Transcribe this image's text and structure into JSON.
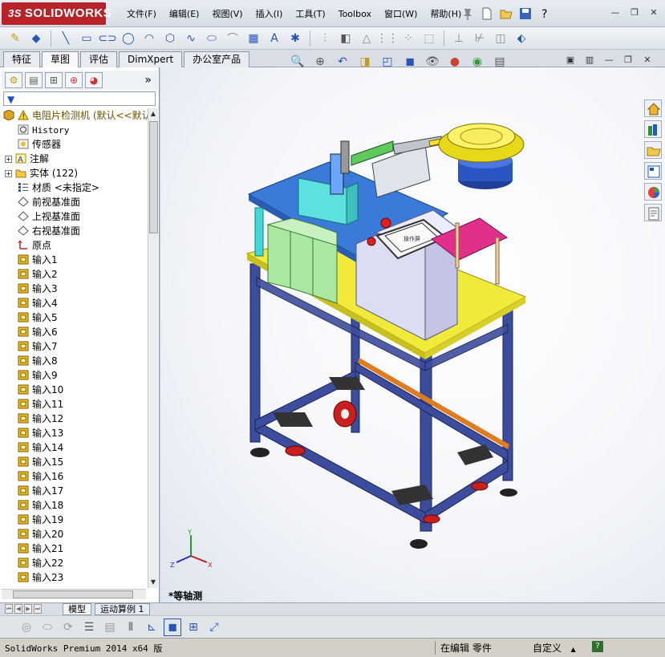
{
  "app": {
    "logo_text": "SOLIDWORKS",
    "logo_prefix": "3S"
  },
  "menu": [
    "文件(F)",
    "编辑(E)",
    "视图(V)",
    "插入(I)",
    "工具(T)",
    "Toolbox",
    "窗口(W)",
    "帮助(H)"
  ],
  "command_tabs": [
    "特征",
    "草图",
    "评估",
    "DimXpert",
    "办公室产品"
  ],
  "active_command_tab": "草图",
  "tree": {
    "root": "电阻片检测机  (默认<<默认",
    "history": "History",
    "sensors": "传感器",
    "annotations": "注解",
    "solid_bodies": "实体 (122)",
    "material": "材质 <未指定>",
    "front_plane": "前视基准面",
    "top_plane": "上视基准面",
    "right_plane": "右视基准面",
    "origin": "原点",
    "inputs": [
      "输入1",
      "输入2",
      "输入3",
      "输入4",
      "输入5",
      "输入6",
      "输入7",
      "输入8",
      "输入9",
      "输入10",
      "输入11",
      "输入12",
      "输入13",
      "输入14",
      "输入15",
      "输入16",
      "输入17",
      "输入18",
      "输入19",
      "输入20",
      "输入21",
      "输入22",
      "输入23"
    ]
  },
  "viewport": {
    "view_label": "*等轴测",
    "triad_x": "X",
    "triad_y": "Y",
    "triad_z": "Z",
    "hmi_screen_text": "操作屏"
  },
  "bottom_tabs": [
    "模型",
    "运动算例 1"
  ],
  "status": {
    "product": "SolidWorks Premium 2014 x64 版",
    "editing": "在编辑 零件",
    "custom": "自定义",
    "custom_arrow": "▲",
    "help": "?"
  },
  "colors": {
    "brand_red": "#b8232a",
    "frame_blue": "#3d4d9e",
    "table_yellow": "#f2ea3a",
    "plate_blue": "#3a7ad8",
    "panel_lavender": "#dcdcf2",
    "accent_magenta": "#e0308a",
    "bowl_yellow": "#e8d81a",
    "wheel_red": "#c8201e"
  },
  "icons": {
    "new": "new-document-icon",
    "open": "open-folder-icon",
    "save": "save-icon",
    "help": "help-icon"
  }
}
